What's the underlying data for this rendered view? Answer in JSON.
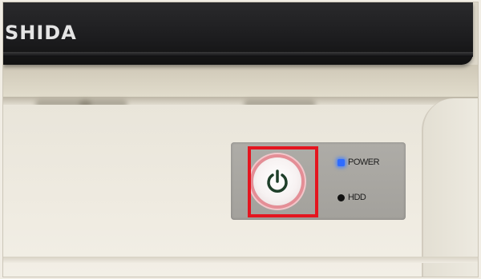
{
  "brand": {
    "text": "SHIDA"
  },
  "power_button": {
    "icon": "power-icon",
    "icon_color": "#1f3f2a",
    "ring_color": "#e48e96"
  },
  "highlight": {
    "color": "#e4151f"
  },
  "indicators": {
    "power": {
      "label": "POWER",
      "led_color": "#2f6cff",
      "state": "on"
    },
    "hdd": {
      "label": "HDD",
      "led_color": "#111111",
      "state": "off"
    }
  }
}
